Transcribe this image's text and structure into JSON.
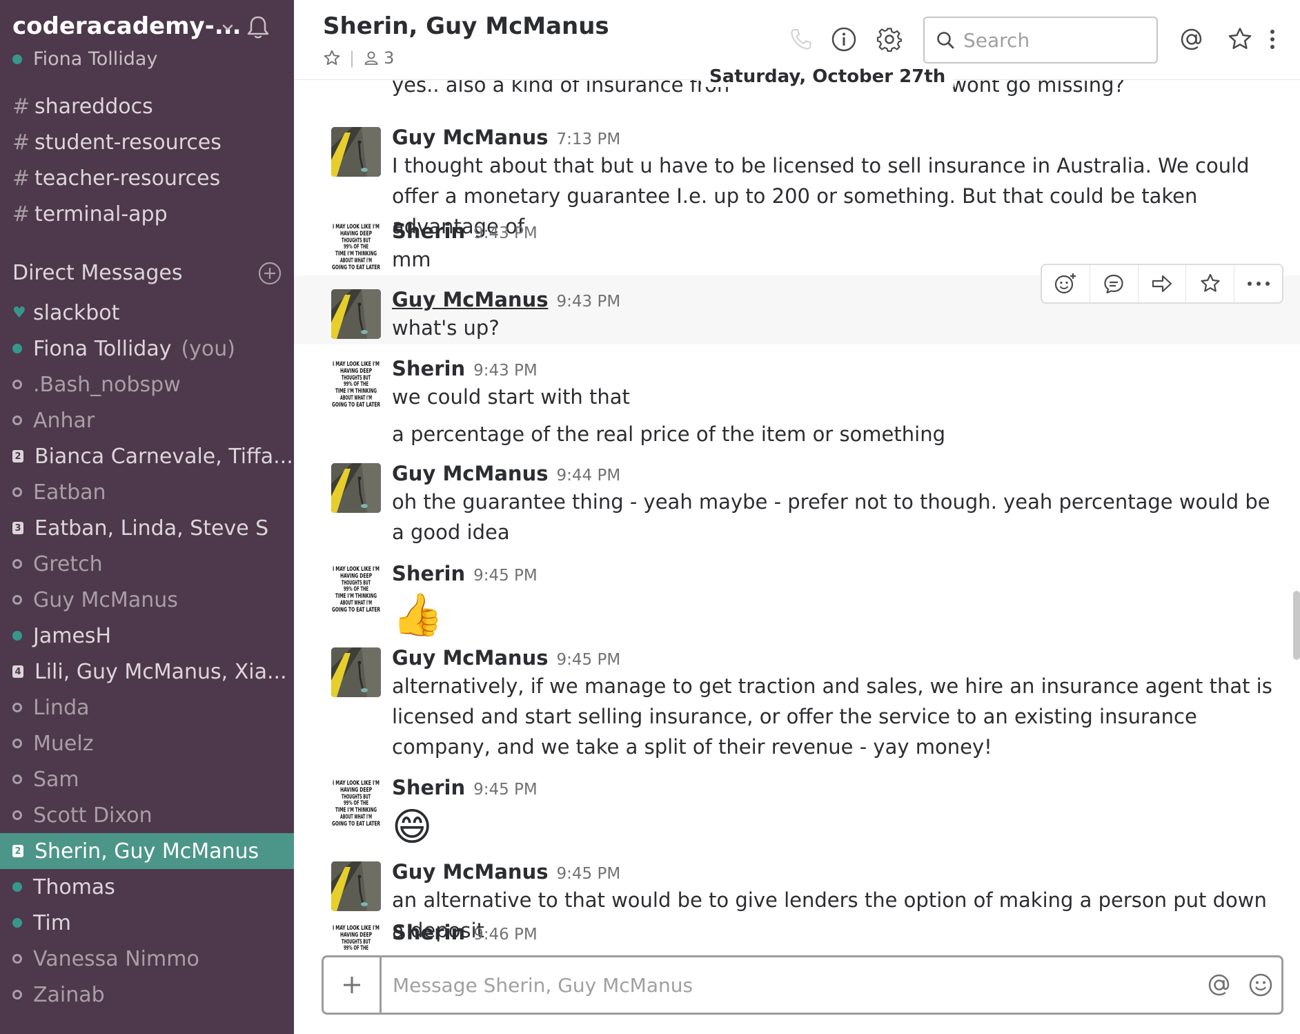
{
  "sidebar": {
    "team_name": "coderacademy-...",
    "user_name": "Fiona Tolliday",
    "channels": [
      {
        "prefix": "#",
        "name": "shareddocs"
      },
      {
        "prefix": "#",
        "name": "student-resources"
      },
      {
        "prefix": "#",
        "name": "teacher-resources"
      },
      {
        "prefix": "#",
        "name": "terminal-app"
      }
    ],
    "dm_header": "Direct Messages",
    "dms": [
      {
        "name": "slackbot",
        "status": "heart",
        "badge": ""
      },
      {
        "name": "Fiona Tolliday",
        "status": "online",
        "badge": "",
        "suffix": "(you)"
      },
      {
        "name": ".Bash_nobspw",
        "status": "away",
        "badge": ""
      },
      {
        "name": "Anhar",
        "status": "away",
        "badge": ""
      },
      {
        "name": "Bianca Carnevale, Tiffa...",
        "status": "group",
        "badge": "2"
      },
      {
        "name": "Eatban",
        "status": "away",
        "badge": ""
      },
      {
        "name": "Eatban, Linda, Steve S",
        "status": "group",
        "badge": "3"
      },
      {
        "name": "Gretch",
        "status": "away",
        "badge": ""
      },
      {
        "name": "Guy McManus",
        "status": "away",
        "badge": ""
      },
      {
        "name": "JamesH",
        "status": "online",
        "badge": ""
      },
      {
        "name": "Lili, Guy McManus, Xia...",
        "status": "group",
        "badge": "4"
      },
      {
        "name": "Linda",
        "status": "away",
        "badge": ""
      },
      {
        "name": "Muelz",
        "status": "away",
        "badge": ""
      },
      {
        "name": "Sam",
        "status": "away",
        "badge": ""
      },
      {
        "name": "Scott Dixon",
        "status": "away",
        "badge": ""
      },
      {
        "name": "Sherin, Guy McManus",
        "status": "group",
        "badge": "2",
        "active": true
      },
      {
        "name": "Thomas",
        "status": "online",
        "badge": ""
      },
      {
        "name": "Tim",
        "status": "online",
        "badge": ""
      },
      {
        "name": "Vanessa Nimmo",
        "status": "away",
        "badge": ""
      },
      {
        "name": "Zainab",
        "status": "away",
        "badge": ""
      }
    ]
  },
  "header": {
    "title": "Sherin, Guy McManus",
    "member_count": "3",
    "search_placeholder": "Search"
  },
  "date_divider": "Saturday, October 27th",
  "cut_message": {
    "left_text": "yes.. also a kind of insurance fron",
    "right_text": "wont go missing?"
  },
  "messages": [
    {
      "author": "Guy McManus",
      "time": "7:13 PM",
      "text": "I thought about that but u have to be licensed to sell insurance in Australia.  We could offer a monetary guarantee I.e. up to 200 or something.  But that could be taken advantage of"
    },
    {
      "author": "Sherin",
      "time": "9:43 PM",
      "text": "mm"
    },
    {
      "author": "Guy McManus",
      "time": "9:43 PM",
      "text": "what's up?"
    },
    {
      "author": "Sherin",
      "time": "9:43 PM",
      "text": "we could start with that",
      "extra": "a percentage of the real price of the item or something"
    },
    {
      "author": "Guy McManus",
      "time": "9:44 PM",
      "text": "oh the guarantee thing - yeah maybe - prefer not to though.  yeah percentage would be a good idea"
    },
    {
      "author": "Sherin",
      "time": "9:45 PM",
      "emoji": "👍"
    },
    {
      "author": "Guy McManus",
      "time": "9:45 PM",
      "text": "alternatively, if we manage to get traction and sales, we hire an insurance agent that is licensed and start selling insurance, or offer the service to an existing insurance company, and we take a split of their revenue - yay money!"
    },
    {
      "author": "Sherin",
      "time": "9:45 PM",
      "emoji": "😄"
    },
    {
      "author": "Guy McManus",
      "time": "9:45 PM",
      "text": "an alternative to that would be to give lenders the option of making a person put down a deposit"
    },
    {
      "author": "Sherin",
      "time": "9:46 PM",
      "text": ""
    }
  ],
  "sherin_avatar_text": "I MAY LOOK LIKE I'M HAVING DEEP THOUGHTS BUT 99% OF THE TIME I'M THINKING ABOUT WHAT I'M GOING TO EAT LATER",
  "composer": {
    "placeholder": "Message Sherin, Guy McManus"
  },
  "colors": {
    "sidebar_bg": "#4d394b",
    "active_item": "#4c9689",
    "presence_online": "#38978d"
  }
}
